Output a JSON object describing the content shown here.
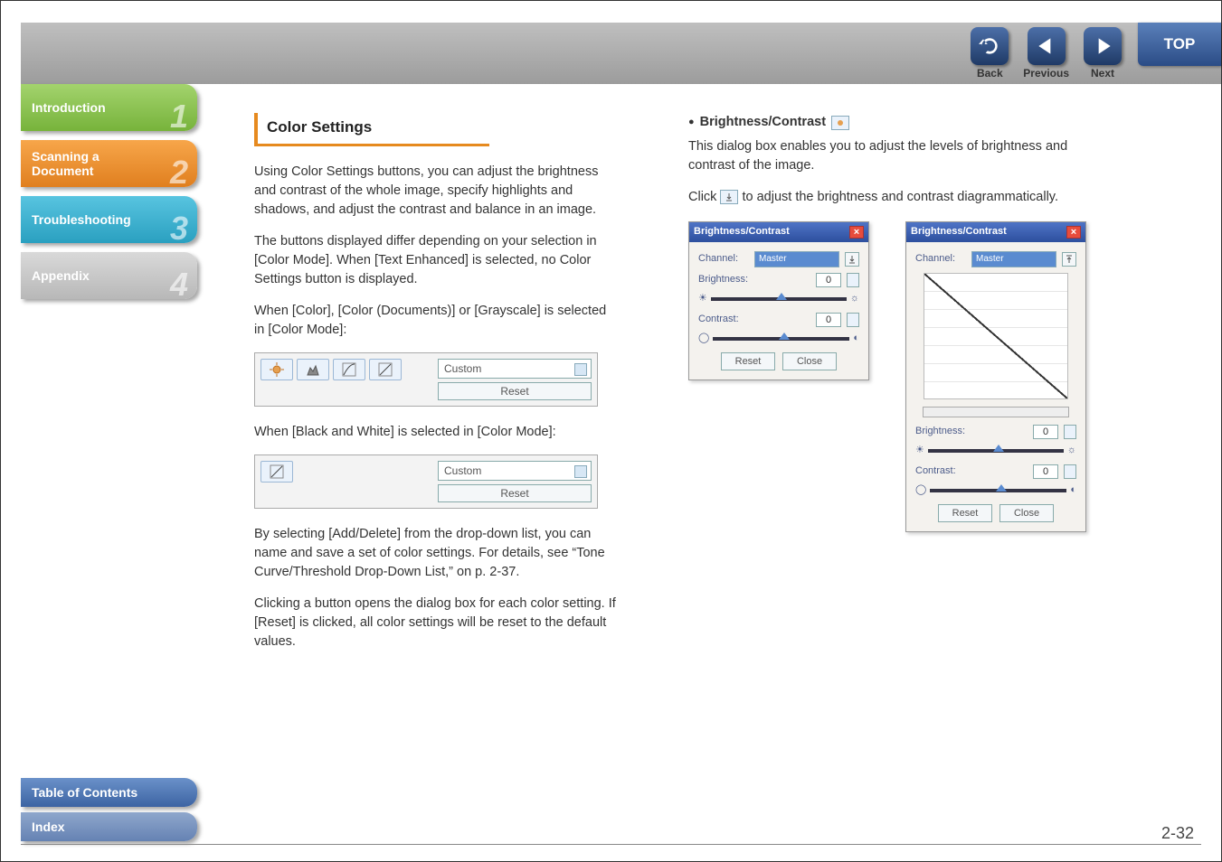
{
  "nav": {
    "back": "Back",
    "previous": "Previous",
    "next": "Next",
    "top": "TOP"
  },
  "sidebar": {
    "intro": "Introduction",
    "intro_num": "1",
    "scan_line1": "Scanning a",
    "scan_line2": "Document",
    "scan_num": "2",
    "trouble": "Troubleshooting",
    "trouble_num": "3",
    "appendix": "Appendix",
    "appendix_num": "4"
  },
  "bottom": {
    "toc": "Table of Contents",
    "index": "Index"
  },
  "left": {
    "title": "Color Settings",
    "p1": "Using Color Settings buttons, you can adjust the brightness and contrast of the whole image, specify highlights and shadows, and adjust the contrast and balance in an image.",
    "p2": "The buttons displayed differ depending on your selection in [Color Mode]. When [Text Enhanced] is selected, no Color Settings button is displayed.",
    "p3": "When [Color], [Color (Documents)] or [Grayscale] is selected in [Color Mode]:",
    "custom": "Custom",
    "reset": "Reset",
    "p4": "When [Black and White] is selected in [Color Mode]:",
    "p5": "By selecting [Add/Delete] from the drop-down list, you can name and save a set of color settings. For details, see “Tone Curve/Threshold Drop-Down List,” on p. 2-37.",
    "p6": "Clicking a button opens the dialog box for each color setting. If [Reset] is clicked, all color settings will be reset to the default values."
  },
  "right": {
    "bc_head": "Brightness/Contrast",
    "p1": "This dialog box enables you to adjust the levels of brightness and contrast of the image.",
    "p2a": "Click ",
    "p2b": " to adjust the brightness and contrast diagrammatically."
  },
  "dialog": {
    "title": "Brightness/Contrast",
    "channel_lbl": "Channel:",
    "channel_val": "Master",
    "brightness_lbl": "Brightness:",
    "brightness_val": "0",
    "contrast_lbl": "Contrast:",
    "contrast_val": "0",
    "reset": "Reset",
    "close": "Close"
  },
  "page_num": "2-32"
}
